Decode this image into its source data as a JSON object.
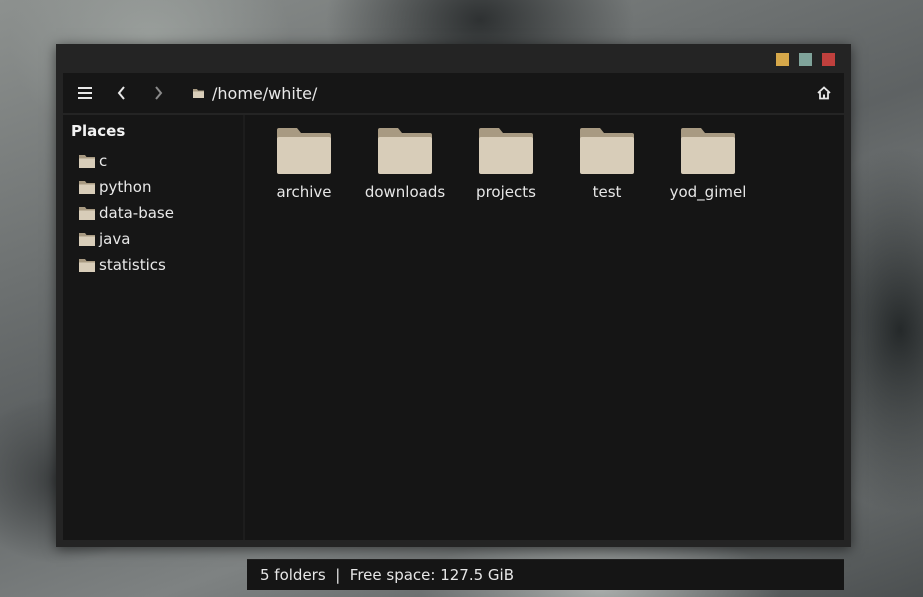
{
  "window": {
    "controls": [
      {
        "name": "minimize",
        "color": "#d6a84a"
      },
      {
        "name": "maximize",
        "color": "#7fa39a"
      },
      {
        "name": "close",
        "color": "#c0403d"
      }
    ]
  },
  "toolbar": {
    "menu_icon": "hamburger-menu-icon",
    "back_icon": "chevron-left-icon",
    "forward_icon": "chevron-right-icon",
    "path": "/home/white/",
    "home_icon": "home-icon"
  },
  "sidebar": {
    "title": "Places",
    "items": [
      {
        "label": "c"
      },
      {
        "label": "python"
      },
      {
        "label": "data-base"
      },
      {
        "label": "java"
      },
      {
        "label": "statistics"
      }
    ]
  },
  "main": {
    "folders": [
      {
        "label": "archive"
      },
      {
        "label": "downloads"
      },
      {
        "label": "projects"
      },
      {
        "label": "test"
      },
      {
        "label": "yod_gimel"
      }
    ]
  },
  "status": {
    "text": "5 folders  |  Free space: 127.5 GiB"
  },
  "colors": {
    "folder_body": "#d8cdb9",
    "folder_tab": "#a89a82",
    "window_bg": "#242424",
    "panel_bg": "#151515"
  }
}
